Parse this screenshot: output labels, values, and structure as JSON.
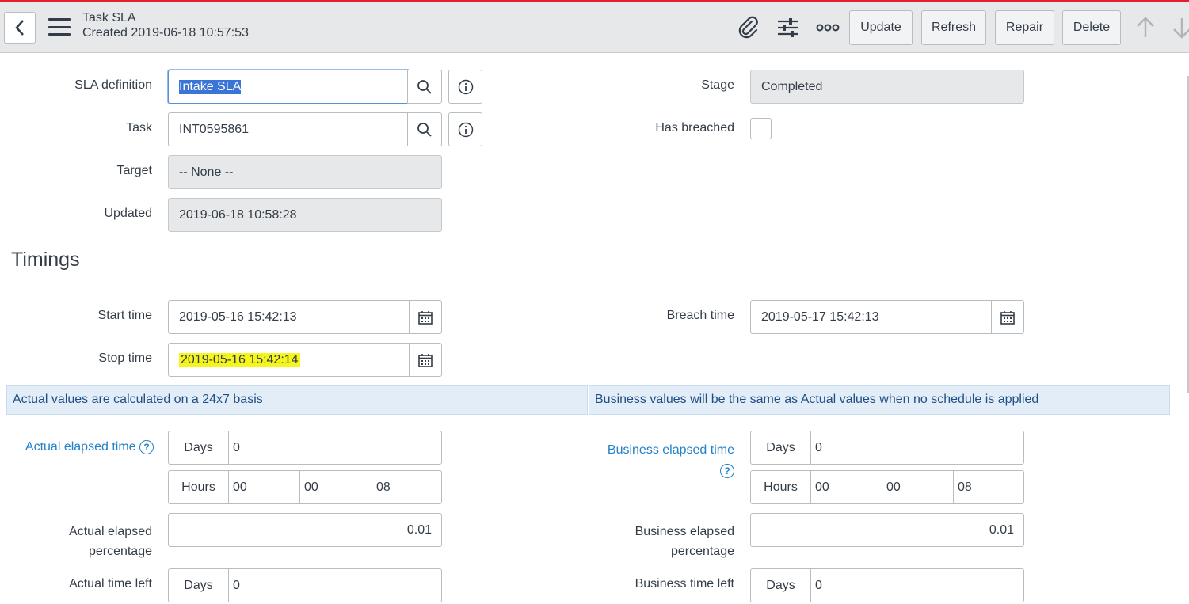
{
  "header": {
    "title": "Task SLA",
    "subtitle": "Created 2019-06-18 10:57:53",
    "buttons": {
      "update": "Update",
      "refresh": "Refresh",
      "repair": "Repair",
      "delete": "Delete"
    },
    "icons": [
      "back-icon",
      "hamburger-icon",
      "paperclip-icon",
      "settings-sliders-icon",
      "more-icon",
      "arrow-up-icon",
      "arrow-down-icon"
    ]
  },
  "form": {
    "sla_definition": {
      "label": "SLA definition",
      "value": "Intake SLA"
    },
    "task": {
      "label": "Task",
      "value": "INT0595861"
    },
    "target": {
      "label": "Target",
      "value": "-- None --"
    },
    "updated": {
      "label": "Updated",
      "value": "2019-06-18 10:58:28"
    },
    "stage": {
      "label": "Stage",
      "value": "Completed"
    },
    "has_breached": {
      "label": "Has breached",
      "checked": false
    }
  },
  "timings": {
    "title": "Timings",
    "start_time": {
      "label": "Start time",
      "value": "2019-05-16 15:42:13"
    },
    "stop_time": {
      "label": "Stop time",
      "value": "2019-05-16 15:42:14"
    },
    "breach_time": {
      "label": "Breach time",
      "value": "2019-05-17 15:42:13"
    },
    "actual_info": "Actual values are calculated on a 24x7 basis",
    "business_info": "Business values will be the same as Actual values when no schedule is applied",
    "days_label": "Days",
    "hours_label": "Hours",
    "actual_elapsed_time": {
      "label": "Actual elapsed time",
      "days": "0",
      "hours": "00",
      "minutes": "00",
      "seconds": "08"
    },
    "actual_elapsed_percentage": {
      "label_line1": "Actual elapsed",
      "label_line2": "percentage",
      "value": "0.01"
    },
    "actual_time_left": {
      "label": "Actual time left",
      "days": "0"
    },
    "business_elapsed_time": {
      "label": "Business elapsed time",
      "days": "0",
      "hours": "00",
      "minutes": "00",
      "seconds": "08"
    },
    "business_elapsed_percentage": {
      "label_line1": "Business elapsed",
      "label_line2": "percentage",
      "value": "0.01"
    },
    "business_time_left": {
      "label": "Business time left",
      "days": "0"
    }
  },
  "colors": {
    "accent_line": "#e2202c",
    "link": "#2381c8",
    "highlight": "#f6f61e",
    "selection": "#3a74d6"
  }
}
